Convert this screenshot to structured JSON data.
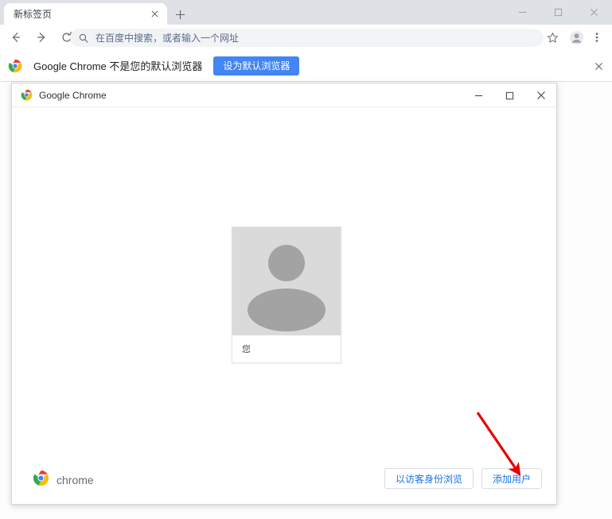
{
  "browser": {
    "tab": {
      "title": "新标签页",
      "close_icon": "close-icon"
    },
    "new_tab_icon": "plus-icon",
    "window_controls": {
      "minimize": "minimize-icon",
      "maximize": "maximize-icon",
      "close": "close-icon"
    },
    "toolbar": {
      "back_icon": "arrow-left-icon",
      "forward_icon": "arrow-right-icon",
      "reload_icon": "reload-icon",
      "search_icon": "search-icon",
      "omnibox_placeholder": "在百度中搜索，或者输入一个网址",
      "bookmark_icon": "star-icon",
      "profile_icon": "account-circle-icon",
      "menu_icon": "three-dots-vertical-icon"
    },
    "infobar": {
      "icon": "chrome-logo-icon",
      "message": "Google Chrome 不是您的默认浏览器",
      "action_label": "设为默认浏览器",
      "close_icon": "close-icon",
      "button_color": "#4285f4"
    }
  },
  "dialog": {
    "icon": "chrome-logo-icon",
    "title": "Google Chrome",
    "window_controls": {
      "minimize": "minimize-icon",
      "maximize": "maximize-icon",
      "close": "close-icon"
    },
    "profiles": [
      {
        "name": "您",
        "avatar_icon": "person-avatar-icon",
        "avatar_bg": "#dadada",
        "avatar_fg": "#a3a3a3"
      }
    ],
    "footer": {
      "brand_icon": "chrome-logo-icon",
      "brand_text": "chrome",
      "guest_label": "以访客身份浏览",
      "add_person_label": "添加用户",
      "link_color": "#1a73e8"
    }
  },
  "annotation": {
    "arrow_color": "#e60000",
    "points_to": "添加用户"
  }
}
